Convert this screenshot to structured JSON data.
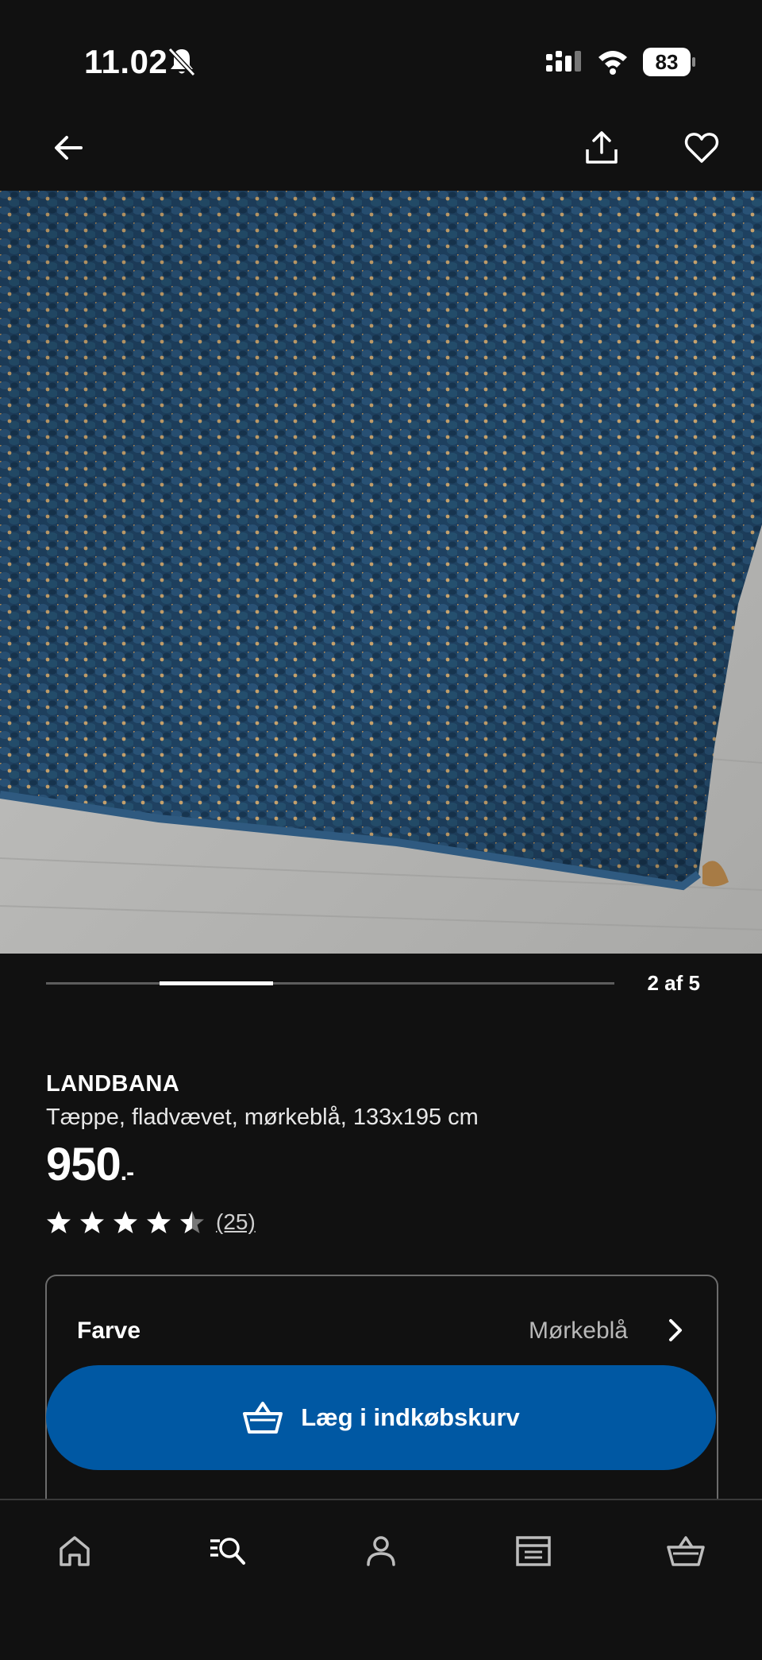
{
  "status_bar": {
    "time": "11.02",
    "battery": "83"
  },
  "product": {
    "name": "LANDBANA",
    "description": "Tæppe, fladvævet, mørkeblå, 133x195 cm",
    "price": "950",
    "price_suffix": ".-",
    "rating": 4.5,
    "review_count": "(25)"
  },
  "carousel": {
    "pager": "2 af 5",
    "current": 2,
    "total": 5
  },
  "options": {
    "label": "Farve",
    "value": "Mørkeblå"
  },
  "cart_button": {
    "label": "Læg i indkøbskurv"
  },
  "bottom_nav": [
    "home-icon",
    "search-icon",
    "profile-icon",
    "store-icon",
    "basket-icon"
  ],
  "colors": {
    "background": "#111111",
    "accent": "#0058a3",
    "rug": "#1d3f5e",
    "jute": "#c9a46e",
    "floor": "#b8b8b6"
  }
}
